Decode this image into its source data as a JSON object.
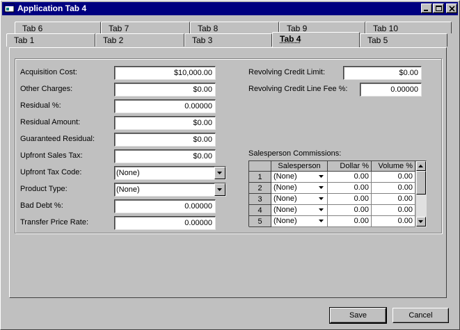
{
  "window": {
    "title": "Application Tab 4"
  },
  "tabs": {
    "back_row": [
      "Tab 6",
      "Tab 7",
      "Tab 8",
      "Tab 9",
      "Tab 10"
    ],
    "front_row": [
      "Tab 1",
      "Tab 2",
      "Tab 3",
      "Tab 4",
      "Tab 5"
    ],
    "active": "Tab 4"
  },
  "left_fields": [
    {
      "label": "Acquisition Cost:",
      "value": "$10,000.00"
    },
    {
      "label": "Other Charges:",
      "value": "$0.00"
    },
    {
      "label": "Residual %:",
      "value": "0.00000"
    },
    {
      "label": "Residual Amount:",
      "value": "$0.00"
    },
    {
      "label": "Guaranteed Residual:",
      "value": "$0.00"
    },
    {
      "label": "Upfront Sales Tax:",
      "value": "$0.00"
    },
    {
      "label": "Upfront Tax Code:",
      "value": "(None)"
    },
    {
      "label": "Product Type:",
      "value": "(None)"
    },
    {
      "label": "Bad Debt %:",
      "value": "0.00000"
    },
    {
      "label": "Transfer Price Rate:",
      "value": "0.00000"
    }
  ],
  "right_fields": [
    {
      "label": "Revolving Credit Limit:",
      "value": "$0.00"
    },
    {
      "label": "Revolving Credit Line Fee %:",
      "value": "0.00000"
    }
  ],
  "commissions": {
    "label": "Salesperson Commissions:",
    "columns": [
      "Salesperson",
      "Dollar %",
      "Volume %"
    ],
    "rows": [
      {
        "num": "1",
        "salesperson": "(None)",
        "dollar": "0.00",
        "volume": "0.00"
      },
      {
        "num": "2",
        "salesperson": "(None)",
        "dollar": "0.00",
        "volume": "0.00"
      },
      {
        "num": "3",
        "salesperson": "(None)",
        "dollar": "0.00",
        "volume": "0.00"
      },
      {
        "num": "4",
        "salesperson": "(None)",
        "dollar": "0.00",
        "volume": "0.00"
      },
      {
        "num": "5",
        "salesperson": "(None)",
        "dollar": "0.00",
        "volume": "0.00"
      }
    ]
  },
  "buttons": {
    "save": "Save",
    "cancel": "Cancel"
  },
  "icons": {
    "title_icon": "app-window-icon",
    "minimize": "minimize-icon",
    "maximize": "maximize-icon",
    "close": "close-icon",
    "dropdown": "chevron-down-icon"
  },
  "colors": {
    "titlebar": "#000080",
    "face": "#c0c0c0"
  }
}
